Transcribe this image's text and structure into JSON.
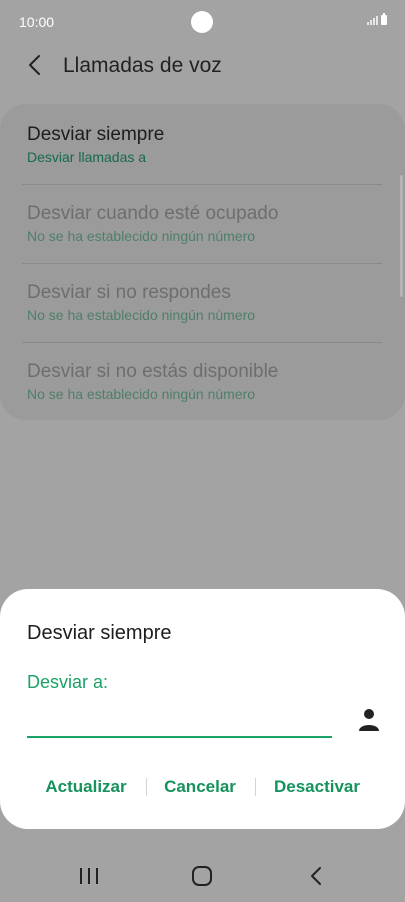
{
  "status_bar": {
    "time": "10:00"
  },
  "header": {
    "title": "Llamadas de voz"
  },
  "settings": [
    {
      "title": "Desviar siempre",
      "subtitle": "Desviar llamadas a",
      "enabled": true
    },
    {
      "title": "Desviar cuando esté ocupado",
      "subtitle": "No se ha establecido ningún número",
      "enabled": false
    },
    {
      "title": "Desviar si no respondes",
      "subtitle": "No se ha establecido ningún número",
      "enabled": false
    },
    {
      "title": "Desviar si no estás disponible",
      "subtitle": "No se ha establecido ningún número",
      "enabled": false
    }
  ],
  "dialog": {
    "title": "Desviar siempre",
    "field_label": "Desviar a:",
    "field_value": "",
    "buttons": [
      "Actualizar",
      "Cancelar",
      "Desactivar"
    ]
  },
  "colors": {
    "accent": "#1aa267",
    "accent_dark": "#166b4a",
    "scrim": "#a3a3a3",
    "dialog_bg": "#ffffff"
  },
  "icons": {
    "back": "chevron-left-icon",
    "contacts": "person-icon",
    "nav_recents": "recents-icon",
    "nav_home": "home-icon",
    "nav_back": "back-icon"
  }
}
